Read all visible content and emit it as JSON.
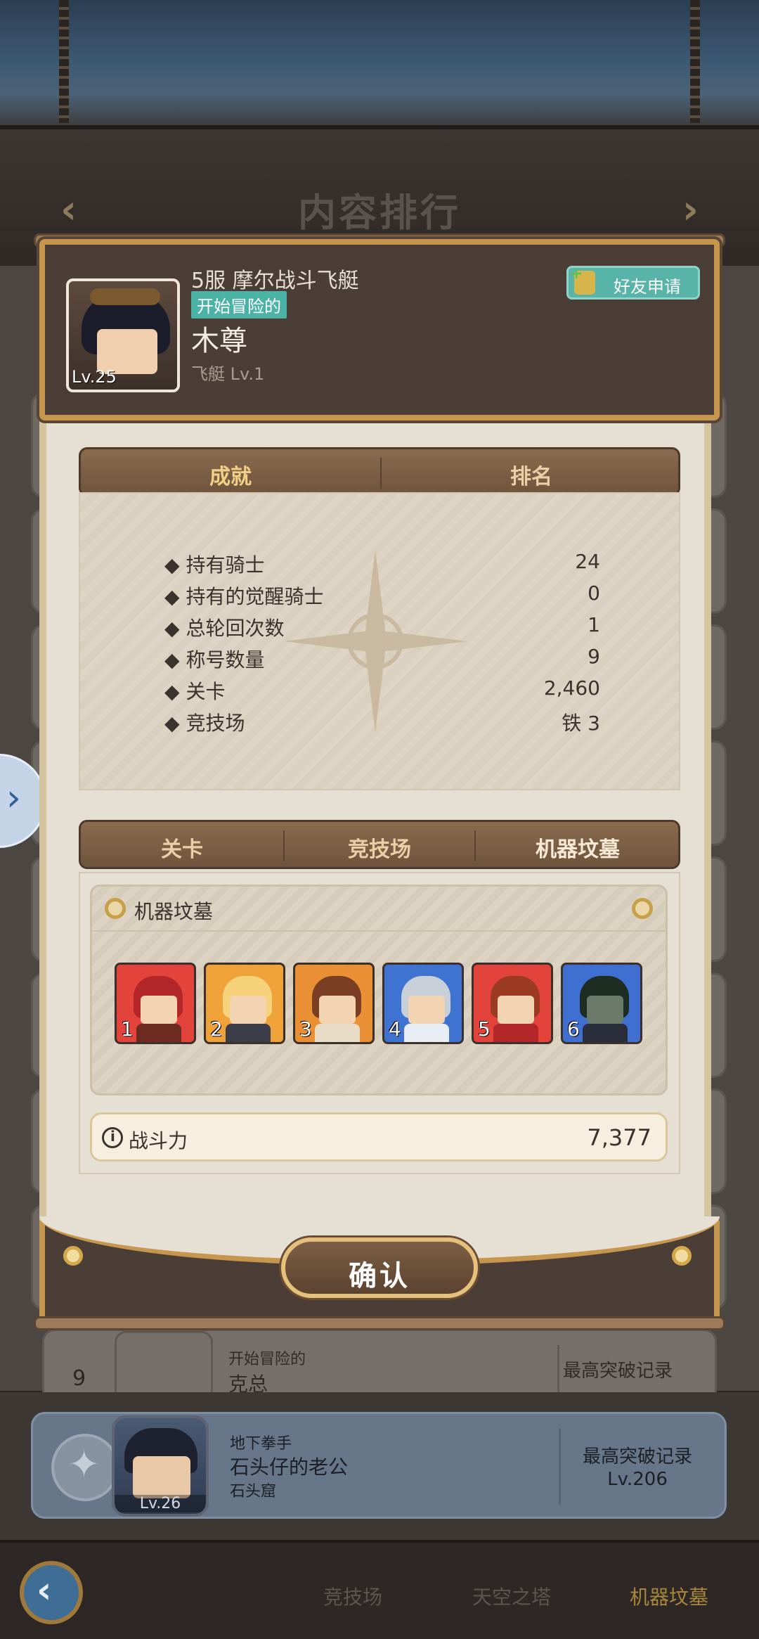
{
  "header": {
    "title": "内容排行"
  },
  "profile": {
    "server_guild": "5服 摩尔战斗飞艇",
    "title_badge": "开始冒险的",
    "name": "木尊",
    "ship": "飞艇 Lv.1",
    "level": "Lv.25",
    "friend_button": "好友申请"
  },
  "top_tabs": [
    {
      "label": "成就",
      "active": true
    },
    {
      "label": "排名",
      "active": false
    }
  ],
  "stats": [
    {
      "label": "持有骑士",
      "value": "24"
    },
    {
      "label": "持有的觉醒骑士",
      "value": "0"
    },
    {
      "label": "总轮回次数",
      "value": "1"
    },
    {
      "label": "称号数量",
      "value": "9"
    },
    {
      "label": "关卡",
      "value": "2,460"
    },
    {
      "label": "竞技场",
      "value": "铁 3"
    }
  ],
  "mode_tabs": [
    {
      "label": "关卡",
      "active": false
    },
    {
      "label": "竞技场",
      "active": false
    },
    {
      "label": "机器坟墓",
      "active": true
    }
  ],
  "tomb": {
    "title": "机器坟墓",
    "heroes": [
      {
        "number": "1",
        "bg": "#e2443c"
      },
      {
        "number": "2",
        "bg": "#f0a23a"
      },
      {
        "number": "3",
        "bg": "#e98f34"
      },
      {
        "number": "4",
        "bg": "#3f73d1"
      },
      {
        "number": "5",
        "bg": "#e2443c"
      },
      {
        "number": "6",
        "bg": "#3f6fd0"
      }
    ]
  },
  "power": {
    "label": "战斗力",
    "value": "7,377"
  },
  "confirm_button": "确认",
  "rank9": {
    "rank": "9",
    "title": "开始冒险的",
    "name": "克总",
    "record_label": "最高突破记录"
  },
  "my_rank": {
    "title": "地下拳手",
    "name": "石头仔的老公",
    "guild": "石头窟",
    "level": "Lv.26",
    "record_label": "最高突破记录",
    "record_value": "Lv.206"
  },
  "bottom_tabs": [
    {
      "label": "竞技场",
      "active": false
    },
    {
      "label": "天空之塔",
      "active": false
    },
    {
      "label": "机器坟墓",
      "active": true
    }
  ],
  "colors": {
    "accent_gold": "#c6964f",
    "active_tab": "#f2cf86",
    "inactive_tab": "#e9cfa6",
    "badge": "#4bb2a6"
  }
}
